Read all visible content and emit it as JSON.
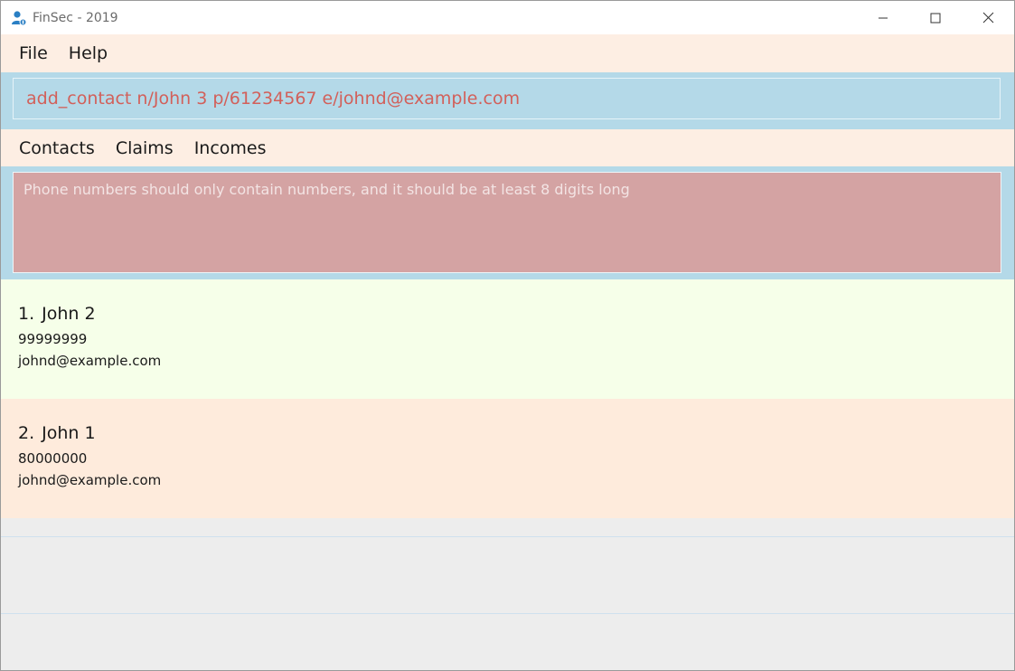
{
  "window": {
    "title": "FinSec - 2019",
    "icon": "user-contact-icon"
  },
  "menu": {
    "items": [
      {
        "label": "File"
      },
      {
        "label": "Help"
      }
    ]
  },
  "command": {
    "value": "add_contact n/John 3 p/61234567 e/johnd@example.com"
  },
  "tabs": {
    "items": [
      {
        "label": "Contacts"
      },
      {
        "label": "Claims"
      },
      {
        "label": "Incomes"
      }
    ]
  },
  "result": {
    "message": "Phone numbers should only contain numbers, and it should be at least 8 digits long"
  },
  "contacts": [
    {
      "index": "1.",
      "name": "John 2",
      "phone": "99999999",
      "email": "johnd@example.com"
    },
    {
      "index": "2.",
      "name": "John 1",
      "phone": "80000000",
      "email": "johnd@example.com"
    }
  ],
  "colors": {
    "menu_bg": "#fdeee3",
    "command_bg": "#b4d9e8",
    "command_text": "#d2605a",
    "result_bg": "#d4a3a3",
    "card_odd": "#f6ffe9",
    "card_even": "#feebdc"
  }
}
